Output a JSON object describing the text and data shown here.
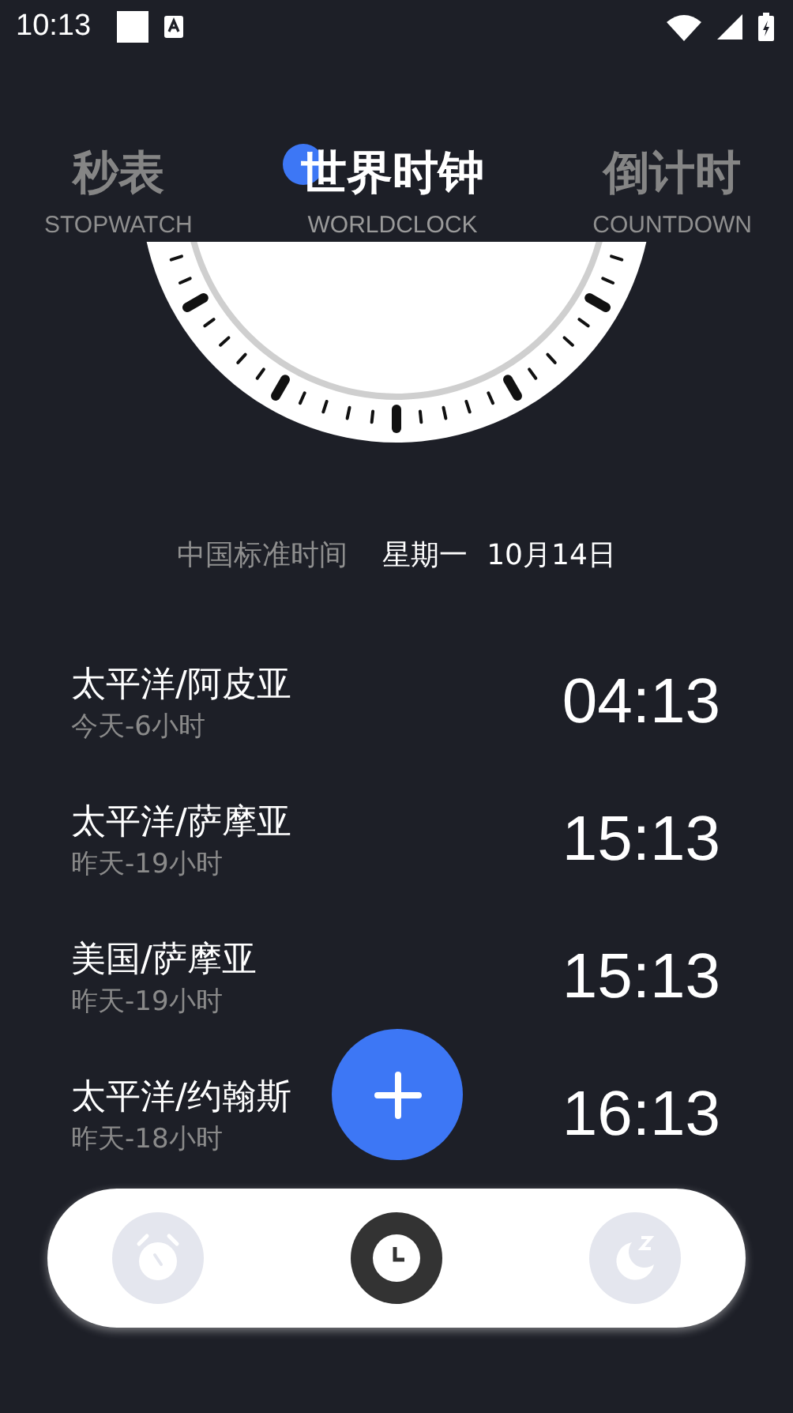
{
  "status_bar": {
    "time": "10:13"
  },
  "tabs": [
    {
      "title": "秒表",
      "subtitle": "STOPWATCH",
      "selected": false
    },
    {
      "title": "世界时钟",
      "subtitle": "WORLDCLOCK",
      "selected": true
    },
    {
      "title": "倒计时",
      "subtitle": "COUNTDOWN",
      "selected": false
    }
  ],
  "local": {
    "zone": "中国标准时间",
    "weekday": "星期一",
    "date": "10月14日"
  },
  "cities": [
    {
      "name": "太平洋/阿皮亚",
      "offset": "今天-6小时",
      "time": "04:13"
    },
    {
      "name": "太平洋/萨摩亚",
      "offset": "昨天-19小时",
      "time": "15:13"
    },
    {
      "name": "美国/萨摩亚",
      "offset": "昨天-19小时",
      "time": "15:13"
    },
    {
      "name": "太平洋/约翰斯",
      "offset": "昨天-18小时",
      "time": "16:13"
    }
  ],
  "nav": [
    {
      "kind": "alarm",
      "selected": false
    },
    {
      "kind": "clock",
      "selected": true
    },
    {
      "kind": "sleep",
      "selected": false
    }
  ]
}
